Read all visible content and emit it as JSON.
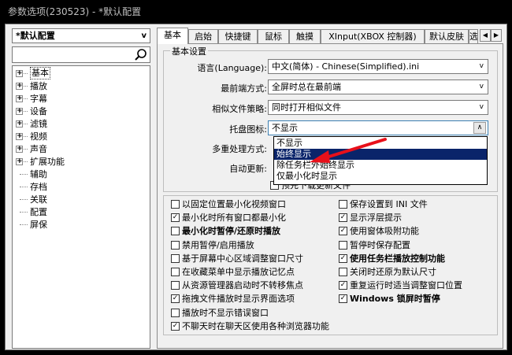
{
  "window": {
    "title": "参数选项(230523) - *默认配置"
  },
  "sidebar": {
    "profile": "*默认配置",
    "tree": [
      {
        "label": "基本",
        "expandable": true,
        "selected": true
      },
      {
        "label": "播放",
        "expandable": true
      },
      {
        "label": "字幕",
        "expandable": true
      },
      {
        "label": "设备",
        "expandable": true
      },
      {
        "label": "滤镜",
        "expandable": true
      },
      {
        "label": "视频",
        "expandable": true
      },
      {
        "label": "声音",
        "expandable": true
      },
      {
        "label": "扩展功能",
        "expandable": true
      },
      {
        "label": "辅助",
        "expandable": false
      },
      {
        "label": "存档",
        "expandable": false
      },
      {
        "label": "关联",
        "expandable": false
      },
      {
        "label": "配置",
        "expandable": false
      },
      {
        "label": "屏保",
        "expandable": false
      }
    ]
  },
  "tabs": [
    "基本",
    "启始",
    "快捷键",
    "鼠标",
    "触摸",
    "XInput(XBOX 控制器)",
    "默认皮肤",
    "选"
  ],
  "basic": {
    "group_label": "基本设置",
    "rows": [
      {
        "label": "语言(Language):",
        "value": "中文(简体) - Chinese(Simplified).ini"
      },
      {
        "label": "最前端方式:",
        "value": "全屏时总在最前端"
      },
      {
        "label": "相似文件策略:",
        "value": "同时打开相似文件"
      },
      {
        "label": "托盘图标:",
        "value": "不显示"
      },
      {
        "label": "多重处理方式:",
        "value": ""
      },
      {
        "label": "自动更新:",
        "value": ""
      }
    ],
    "tray_options": [
      "不显示",
      "始终显示",
      "除任务栏外始终显示",
      "仅最小化时显示"
    ],
    "preload_label": "预先下载更新文件"
  },
  "checks_left": [
    {
      "label": "以固定位置最小化视频窗口",
      "checked": false,
      "bold": false
    },
    {
      "label": "最小化时所有窗口都最小化",
      "checked": true,
      "bold": false
    },
    {
      "label": "最小化时暂停/还原时播放",
      "checked": false,
      "bold": true
    },
    {
      "label": "禁用暂停/启用播放",
      "checked": false,
      "bold": false
    },
    {
      "label": "基于屏幕中心区域调整窗口尺寸",
      "checked": false,
      "bold": false
    },
    {
      "label": "在收藏菜单中显示播放记忆点",
      "checked": false,
      "bold": false
    },
    {
      "label": "从资源管理器启动时不转移焦点",
      "checked": false,
      "bold": false
    },
    {
      "label": "拖拽文件播放时显示界面选项",
      "checked": true,
      "bold": false
    },
    {
      "label": "播放时不显示错误窗口",
      "checked": false,
      "bold": false
    },
    {
      "label": "不聊天时在聊天区使用各种浏览器功能",
      "checked": true,
      "bold": false
    }
  ],
  "checks_right": [
    {
      "label": "保存设置到 INI 文件",
      "checked": false,
      "bold": false
    },
    {
      "label": "显示浮层提示",
      "checked": true,
      "bold": false
    },
    {
      "label": "使用窗体吸附功能",
      "checked": true,
      "bold": false
    },
    {
      "label": "暂停时保存配置",
      "checked": false,
      "bold": false
    },
    {
      "label": "使用任务栏播放控制功能",
      "checked": true,
      "bold": true
    },
    {
      "label": "关闭时还原为默认尺寸",
      "checked": false,
      "bold": false
    },
    {
      "label": "重复运行时适当调整窗口位置",
      "checked": true,
      "bold": false
    },
    {
      "label": "Windows 锁屏时暂停",
      "checked": true,
      "bold": true
    }
  ],
  "icons": {
    "search": "search-icon",
    "annotation": "red-arrow"
  }
}
